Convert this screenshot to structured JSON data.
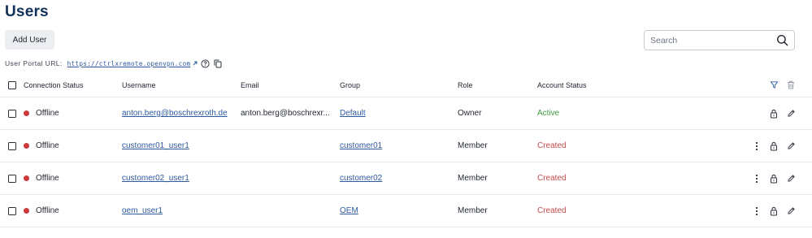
{
  "page": {
    "title": "Users"
  },
  "toolbar": {
    "add_user_label": "Add User"
  },
  "search": {
    "placeholder": "Search",
    "value": ""
  },
  "portal": {
    "label": "User Portal URL:",
    "url": "https://ctrlxremote.openvpn.com"
  },
  "table": {
    "columns": {
      "connection_status": "Connection Status",
      "username": "Username",
      "email": "Email",
      "group": "Group",
      "role": "Role",
      "account_status": "Account Status"
    },
    "rows": [
      {
        "connection_status": "Offline",
        "username": "anton.berg@boschrexroth.de",
        "email": "anton.berg@boschrexr...",
        "group": "Default",
        "role": "Owner",
        "account_status": "Active"
      },
      {
        "connection_status": "Offline",
        "username": "customer01_user1",
        "email": "",
        "group": "customer01",
        "role": "Member",
        "account_status": "Created"
      },
      {
        "connection_status": "Offline",
        "username": "customer02_user1",
        "email": "",
        "group": "customer02",
        "role": "Member",
        "account_status": "Created"
      },
      {
        "connection_status": "Offline",
        "username": "oem_user1",
        "email": "",
        "group": "OEM",
        "role": "Member",
        "account_status": "Created"
      }
    ]
  },
  "colors": {
    "title": "#11305a",
    "link": "#2d5aa0",
    "offline_dot": "#c9393a",
    "active": "#3f9b43",
    "created": "#c64a4a"
  },
  "icons": {
    "search": "search-icon",
    "external_link": "external-link-icon",
    "help": "help-icon",
    "copy": "copy-icon",
    "filter": "filter-icon",
    "delete": "trash-icon",
    "more": "more-vertical-icon",
    "lock": "lock-icon",
    "edit": "pencil-icon"
  }
}
